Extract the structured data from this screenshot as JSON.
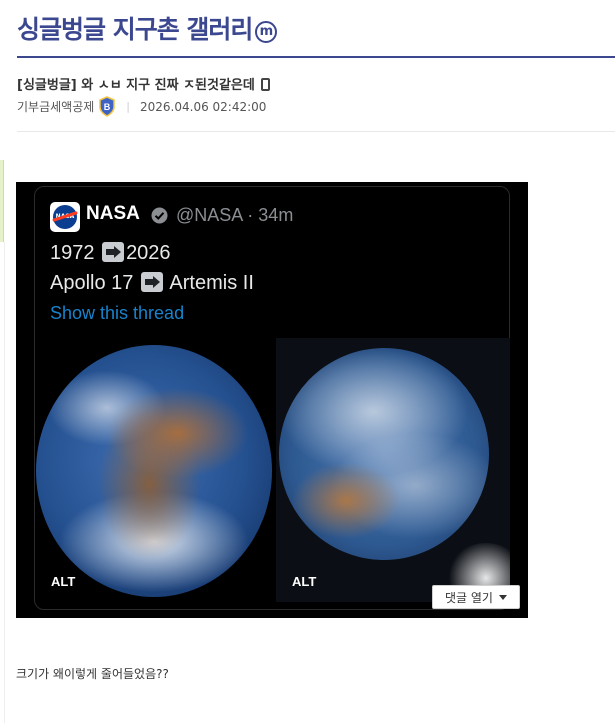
{
  "gallery": {
    "title": "싱글벙글 지구촌 갤러리",
    "badge_letter": "m"
  },
  "post": {
    "title": "[싱글벙글] 와 ㅅㅂ 지구 진짜 ㅈ된것같은데",
    "author": "기부금세액공제",
    "author_badge": "B",
    "date": "2026.04.06 02:42:00",
    "body": "크기가 왜이렇게 줄어들었음??"
  },
  "embedded_image": {
    "account_name": "NASA",
    "account_handle": "@NASA · 34m",
    "line1_left": "1972",
    "line1_right": "2026",
    "line2_left": "Apollo 17",
    "line2_right": "Artemis II",
    "thread_link": "Show this thread",
    "alt_left": "ALT",
    "alt_right": "ALT",
    "logo_text": "NASA"
  },
  "comment_button": {
    "label": "댓글 열기"
  },
  "colors": {
    "brand": "#3b4890",
    "link_blue": "#1d9bf0",
    "nasa_blue": "#0b3d91",
    "nasa_red": "#fc3d21"
  }
}
